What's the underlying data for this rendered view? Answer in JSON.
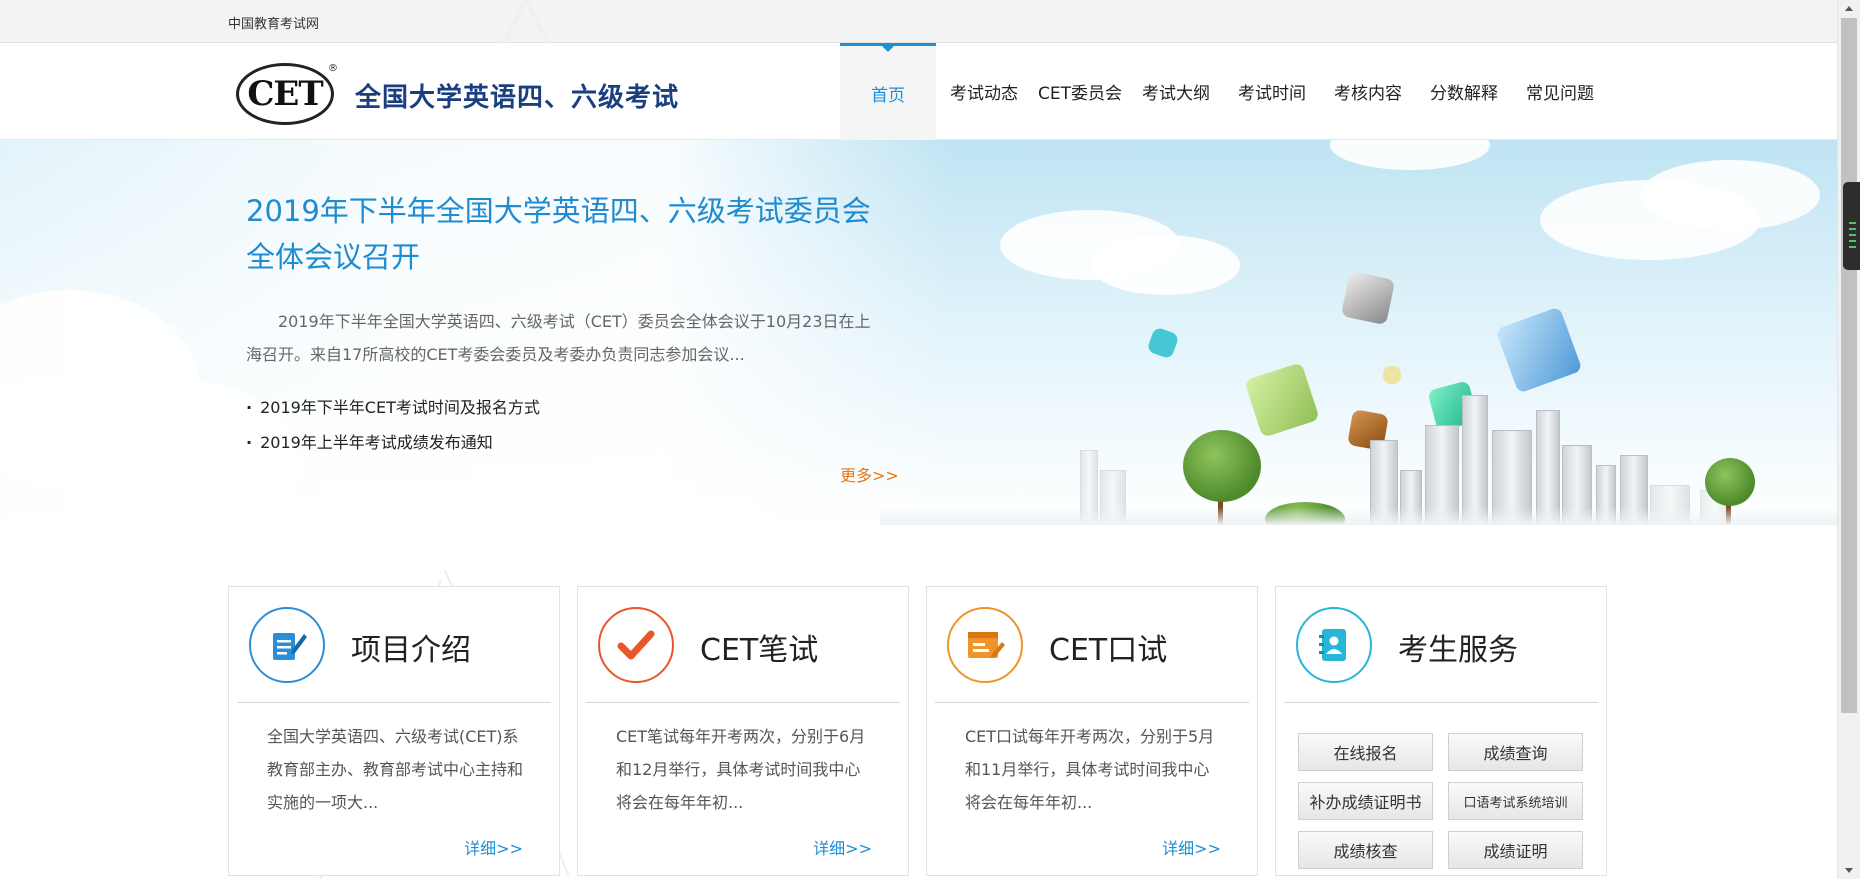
{
  "topbar": {
    "site_name": "中国教育考试网"
  },
  "header": {
    "logo_text": "CET",
    "logo_reg": "®",
    "title": "全国大学英语四、六级考试",
    "nav": [
      {
        "label": "首页",
        "active": true
      },
      {
        "label": "考试动态"
      },
      {
        "label": "CET委员会"
      },
      {
        "label": "考试大纲"
      },
      {
        "label": "考试时间"
      },
      {
        "label": "考核内容"
      },
      {
        "label": "分数解释"
      },
      {
        "label": "常见问题"
      }
    ]
  },
  "banner": {
    "title": "2019年下半年全国大学英语四、六级考试委员会全体会议召开",
    "description": "2019年下半年全国大学英语四、六级考试（CET）委员会全体会议于10月23日在上海召开。来自17所高校的CET考委会委员及考委办负责同志参加会议...",
    "links": [
      "2019年下半年CET考试时间及报名方式",
      "2019年上半年考试成绩发布通知"
    ],
    "more": "更多>>"
  },
  "cards": [
    {
      "icon": "document-edit-icon",
      "color": "#2a8fd8",
      "title": "项目介绍",
      "body": "全国大学英语四、六级考试(CET)系教育部主办、教育部考试中心主持和实施的一项大...",
      "more": "详细>>"
    },
    {
      "icon": "checkmark-icon",
      "color": "#e8562a",
      "title": "CET笔试",
      "body": "CET笔试每年开考两次，分别于6月和12月举行，具体考试时间我中心将会在每年年初...",
      "more": "详细>>"
    },
    {
      "icon": "id-card-icon",
      "color": "#f0932b",
      "title": "CET口试",
      "body": "CET口试每年开考两次，分别于5月和11月举行，具体考试时间我中心将会在每年年初...",
      "more": "详细>>"
    },
    {
      "icon": "contact-book-icon",
      "color": "#27b5d8",
      "title": "考生服务",
      "buttons": [
        "在线报名",
        "成绩查询",
        "补办成绩证明书",
        "口语考试系统培训",
        "成绩核查",
        "成绩证明"
      ]
    }
  ]
}
